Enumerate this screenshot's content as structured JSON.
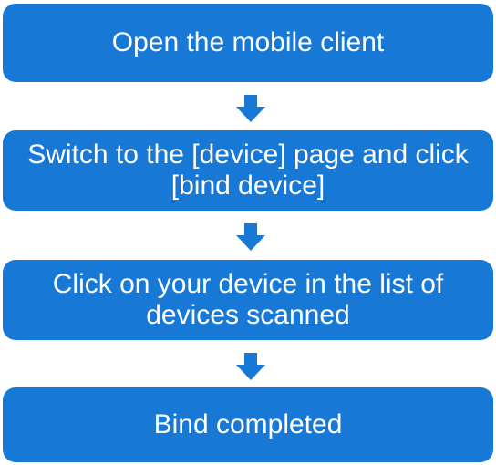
{
  "colors": {
    "box_fill": "#1878d6",
    "arrow_fill": "#1878d6",
    "text": "#ffffff",
    "background": "#ffffff"
  },
  "steps": [
    {
      "text": "Open the mobile client"
    },
    {
      "text": "Switch to the [device] page and click\n[bind device]"
    },
    {
      "text": "Click on your device in the list of\ndevices scanned"
    },
    {
      "text": "Bind completed"
    }
  ],
  "arrows": [
    {
      "icon": "arrow-down-icon"
    },
    {
      "icon": "arrow-down-icon"
    },
    {
      "icon": "arrow-down-icon"
    }
  ]
}
